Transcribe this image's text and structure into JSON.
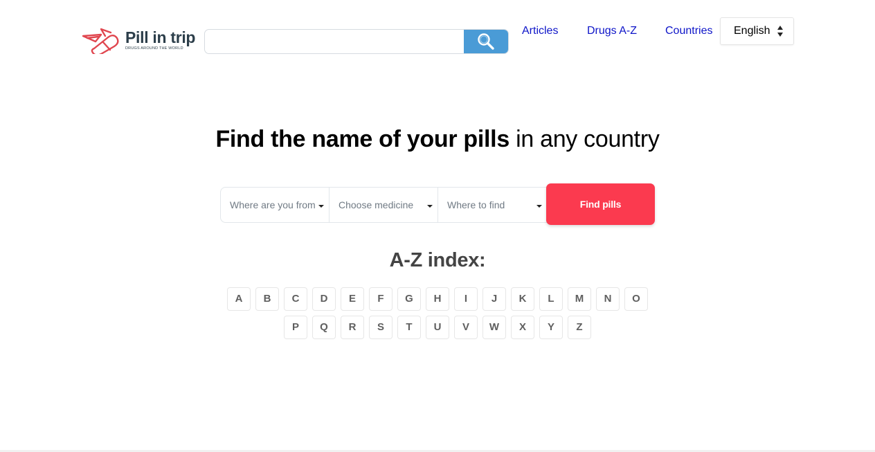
{
  "header": {
    "logo": {
      "name": "Pill in trip",
      "tagline": "DRUGS AROUND THE WORLD"
    },
    "search": {
      "placeholder": "",
      "icon": "search-icon"
    },
    "nav": [
      {
        "label": "Articles"
      },
      {
        "label": "Drugs A-Z"
      },
      {
        "label": "Countries"
      }
    ],
    "language": {
      "selected": "English",
      "icon": "sort-arrows-icon"
    }
  },
  "hero": {
    "title_bold": "Find the name of your pills",
    "title_rest": " in any country"
  },
  "finder": {
    "from_placeholder": "Where are you from",
    "medicine_placeholder": "Choose medicine",
    "where_placeholder": "Where to find",
    "button_label": "Find pills"
  },
  "az_index": {
    "title": "A-Z index:",
    "row1": [
      "A",
      "B",
      "C",
      "D",
      "E",
      "F",
      "G",
      "H",
      "I",
      "J",
      "K",
      "L",
      "M",
      "N",
      "O"
    ],
    "row2": [
      "P",
      "Q",
      "R",
      "S",
      "T",
      "U",
      "V",
      "W",
      "X",
      "Y",
      "Z"
    ]
  },
  "colors": {
    "accent_blue": "#4a9bd6",
    "link_blue": "#0d14c8",
    "find_button_red": "#fb3a4f",
    "logo_red": "#e0464f"
  }
}
